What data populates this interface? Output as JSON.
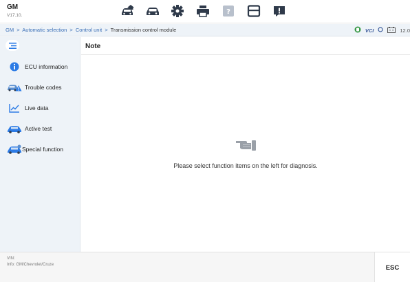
{
  "app": {
    "title": "GM",
    "version": "V17.10."
  },
  "toolbar": {
    "icons": [
      "car-home-icon",
      "car-icon",
      "gear-icon",
      "print-icon",
      "help-icon",
      "save-icon",
      "feedback-icon"
    ]
  },
  "breadcrumb": {
    "items": [
      "GM",
      "Automatic selection",
      "Control unit"
    ],
    "separator": ">",
    "current": "Transmission control module"
  },
  "status": {
    "vci_label": "VCI",
    "battery_voltage": "12.0"
  },
  "sidebar": {
    "items": [
      {
        "label": "ECU information",
        "icon": "info-icon"
      },
      {
        "label": "Trouble codes",
        "icon": "car-warning-icon"
      },
      {
        "label": "Live data",
        "icon": "line-chart-icon"
      },
      {
        "label": "Active test",
        "icon": "car-test-icon"
      },
      {
        "label": "Special function",
        "icon": "car-function-icon"
      }
    ]
  },
  "main": {
    "title": "Note",
    "message": "Please select function items on the left for diagnosis."
  },
  "footer": {
    "vin": "VIN:",
    "info": "Info: GM/Chevrolet/Cruze",
    "esc_label": "ESC"
  },
  "colors": {
    "accent": "#3b6fb6",
    "sidebar_bg": "#eef3f8",
    "icon_dark": "#2f3a4a",
    "info_blue": "#2c7be5"
  }
}
